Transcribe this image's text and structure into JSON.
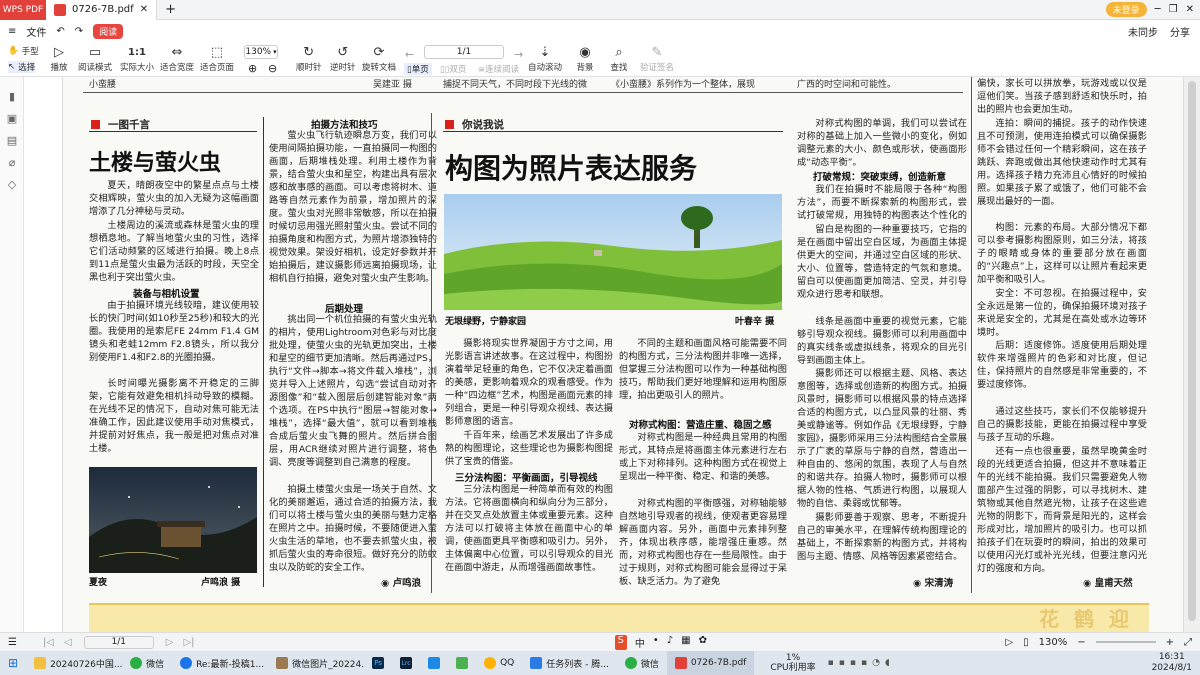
{
  "app": {
    "brand": "WPS PDF",
    "tab_title": "0726-7B.pdf",
    "new_tab": "+",
    "login": "未登录",
    "window_controls": [
      "─",
      "❐",
      "✕"
    ]
  },
  "menu": {
    "file": "文件",
    "reading": "阅读",
    "right": [
      "未同步",
      "分享"
    ]
  },
  "toolbar": {
    "hand": "手型",
    "select": "选择",
    "play": "播放",
    "read_mode": "阅读模式",
    "actual_size": "实际大小",
    "fit_width": "适合宽度",
    "fit_page": "适合页面",
    "zoom": "130%",
    "rotate_cw": "顺时针",
    "rotate_ccw": "逆时针",
    "rotate_doc": "旋转文档",
    "single": "单页",
    "double": "双页",
    "continuous": "连续阅读",
    "auto_scroll": "自动滚动",
    "background": "背景",
    "search": "查找",
    "verify": "验证签名",
    "page_input": "1/1"
  },
  "newspaper": {
    "top_fragments": [
      "小蛮腰",
      "吴建亚 摄",
      "捕捉不同天气，不同时段下光线的微",
      "《小蛮腰》系列作为一个整体，展现",
      "广西的时空间和可能性。"
    ],
    "col1": {
      "section": "一图千言",
      "headline": "土楼与萤火虫",
      "p1": "夏天，晴朗夜空中的繁星点点与土楼交相辉映，萤火虫的加入无疑为这幅画面增添了几分神秘与灵动。",
      "p2": "土楼周边的溪流或森林是萤火虫的理想栖息地。了解当地萤火虫的习性，选择它们活动频繁的区域进行拍摄。晚上8点到11点是萤火虫最为活跃的时段，天空全黑也利于突出萤火虫。",
      "sub": "装备与相机设置",
      "p3": "由于拍摄环境光线较暗，建议使用较长的快门时间(如10秒至25秒)和较大的光圈。我使用的是索尼FE 24mm F1.4 GM镜头和老蛙12mm F2.8镜头，所以我分别使用F1.4和F2.8的光圈拍摄。",
      "p4": "长时间曝光摄影离不开稳定的三脚架，它能有效避免相机抖动导致的模糊。在光线不足的情况下，自动对焦可能无法准确工作，因此建议使用手动对焦模式，并提前对好焦点，我一般是把对焦点对准土楼。",
      "caption": "夏夜",
      "credit": "卢鸣浪 摄"
    },
    "col2": {
      "sub1": "拍摄方法和技巧",
      "p1": "萤火虫飞行轨迹瞬息万变，我们可以使用间隔拍摄功能，一直拍摄同一构图的画面，后期堆栈处理。利用土楼作为背景，结合萤火虫和星空，构建出具有层次感和故事感的画面。可以考虑将树木、道路等自然元素作为前景，增加照片的深度。萤火虫对光照非常敏感，所以在拍摄时候切忌用强光照射萤火虫。尝试不同的拍摄角度和构图方式，为照片增添独特的视觉效果。架设好相机，设定好参数并开始拍摄后，建议摄影师远离拍摄现场，让相机自行拍摄，避免对萤火虫产生影响。",
      "sub2": "后期处理",
      "p2": "挑出同一个机位拍摄的有萤火虫光轨的相片，使用Lightroom对色彩与对比度批处理，使萤火虫的光轨更加突出，土楼和星空的细节更加清晰。然后再通过PS，执行“文件→脚本→将文件载入堆栈”，浏览并导入上述照片，勾选“尝试自动对齐源图像”和“载入图层后创建智能对象”两个选项。在PS中执行“图层→智能对象→堆栈”，选择“最大值”，就可以看到堆栈合成后萤火虫飞舞的照片。然后拼合图层，用ACR继续对照片进行调整，将色调、亮度等调整到自己满意的程度。",
      "p3": "拍摄土楼萤火虫是一场关于自然、文化的美丽邂逅，通过合适的拍摄方法，我们可以将土楼与萤火虫的美丽与魅力定格在照片之中。拍摄时候，不要随便进入萤火虫生活的草地，也不要去抓萤火虫，被抓后萤火虫的寿命很短。做好充分的防蚊虫以及防蛇的安全工作。",
      "author": "卢鸣浪"
    },
    "col3": {
      "section": "你说我说",
      "headline": "构图为照片表达服务",
      "caption": "无垠绿野，宁静家园",
      "credit": "叶春辛 摄",
      "p1": "摄影将现实世界凝固于方寸之间，用光影语言讲述故事。在这过程中，构图扮演着举足轻重的角色，它不仅决定着画面的美感，更影响着观众的观看感受。作为一种“四边框”艺术，构图是画面元素的排列组合，更是一种引导观众视线、表达摄影师意图的语言。",
      "p2": "千百年来，绘画艺术发展出了许多成熟的构图理论，这些理论也为摄影构图提供了宝贵的借鉴。",
      "sub": "三分法构图：平衡画面，引导视线",
      "p3": "三分法构图是一种简单而有效的构图方法。它将画面横向和纵向分为三部分，并在交叉点处放置主体或重要元素。这种方法可以打破将主体放在画面中心的单调，使画面更具平衡感和吸引力。另外，主体偏离中心位置，可以引导观众的目光在画面中游走，从而增强画面故事性。"
    },
    "col4": {
      "p1": "不同的主题和画面风格可能需要不同的构图方式，三分法构图并非唯一选择，但掌握三分法构图可以作为一种基础构图技巧，帮助我们更好地理解和运用构图原理，拍出更吸引人的照片。",
      "sub": "对称式构图：营造庄重、稳固之感",
      "p2": "对称式构图是一种经典且常用的构图形式，其特点是将画面主体元素进行左右或上下对称排列。这种构图方式在视觉上呈现出一种平衡、稳定、和谐的美感。",
      "p3": "对称式构图的平衡感强，对称轴能够自然地引导观者的视线，使观者更容易理解画面内容。另外，画面中元素排列整齐，体现出秩序感，能增强庄重感。然而，对称式构图也存在一些局限性。由于过于规则，对称式构图可能会显得过于呆板、缺乏活力。为了避免"
    },
    "col5": {
      "p1": "对称式构图的单调，我们可以尝试在对称的基础上加入一些微小的变化，例如调整元素的大小、颜色或形状，使画面形成“动态平衡”。",
      "sub": "打破常规：突破束缚，创造新意",
      "p2": "我们在拍摄时不能局限于各种“构图方法”，而要不断探索新的构图形式，尝试打破常规，用独特的构图表达个性化的审美理念。",
      "p3": "留白是构图的一种重要技巧，它指的是在画面中留出空白区域，为画面主体提供更大的空间，并通过空白区域的形状、大小、位置等，营造特定的气氛和意境。留白可以使画面更加简洁、空灵，并引导观众进行思考和联想。",
      "p4": "线条是画面中重要的视觉元素，它能够引导观众视线。摄影师可以利用画面中的真实线条或虚拟线条，将观众的目光引导到画面主体上。",
      "p5": "摄影师还可以根据主题、风格、表达意图等，选择或创造新的构图方式。拍摄风景时，摄影师可以根据风景的特点选择合适的构图方式，以凸显风景的壮丽、秀美或静谧等。例如作品《无垠绿野，宁静家园》，摄影师采用三分法构图结合全景展示了广袤的草原与宁静的自然，营造出一种自由的、悠闲的氛围，表现了人与自然的和谐共存。拍摄人物时，摄影师可以根据人物的性格、气质进行构图，以展现人物的自信、柔弱或忧郁等。",
      "p6": "摄影师要善于观察、思考，不断提升自己的审美水平，在理解传统构图理论的基础上，不断探索新的构图方式，并将构图与主题、情感、风格等因素紧密结合。",
      "author": "宋清涛"
    },
    "col6": {
      "p1": "偏快，家长可以拼放拳，玩游戏或以仪是逗他们笑。当孩子感到舒适和快乐时，拍出的照片也会更加生动。",
      "p2": "连拍：瞬间的捕捉。孩子的动作快速且不可预测，使用连拍模式可以确保摄影师不会错过任何一个精彩瞬间，这在孩子跳跃、奔跑或做出其他快速动作时尤其有用。选择孩子精力充沛且心情好的时候拍照。如果孩子累了或饿了，他们可能不会展现出最好的一面。",
      "p3": "构图：元素的布局。大部分情况下都可以参考摄影构图原则，如三分法，将孩子的眼睛或身体的重要部分放在画面的“兴趣点”上，这样可以让照片看起来更加平衡和吸引人。",
      "p4": "安全：不可忽视。在拍摄过程中，安全永远是第一位的，确保拍摄环境对孩子来说是安全的，尤其是在高处或水边等环境时。",
      "p5": "后期：适度修饰。适度使用后期处理软件来增强照片的色彩和对比度，但记住，保持照片的自然感是非常重要的，不要过度修饰。",
      "p6": "通过这些技巧，家长们不仅能够提升自己的摄影技能，更能在拍摄过程中享受与孩子互动的乐趣。",
      "p7": "还有一点也很重要，虽然早晚黄金时段的光线更适合拍摄，但这并不意味着正午的光线不能拍摄。我们只需要避免人物面部产生过强的阴影，可以寻找树木、建筑物或其他自然遮光物，让孩子在这些遮光物的阴影下，而背景是阳光的，这样会形成对比，增加照片的吸引力。也可以抓拍孩子们在玩耍时的瞬间，拍出的效果可以使用闪光灯或补光光线，但要注意闪光灯的强度和方向。",
      "author": "皇甫天然"
    },
    "banner_fragment": "花 鹤 迎 于"
  },
  "status": {
    "page": "1/1",
    "zoom": "130%"
  },
  "taskbar": {
    "items": [
      "20240726中国...",
      "微信",
      "Re:最新-投稿1...",
      "微信图片_20224...",
      "Ps",
      "Lrc",
      "QQ",
      "任务列表 - 腾...",
      "微信",
      "0726-7B.pdf"
    ],
    "cpu_percent": "1%",
    "cpu_label": "CPU利用率",
    "time": "16:31",
    "date": "2024/8/1"
  }
}
